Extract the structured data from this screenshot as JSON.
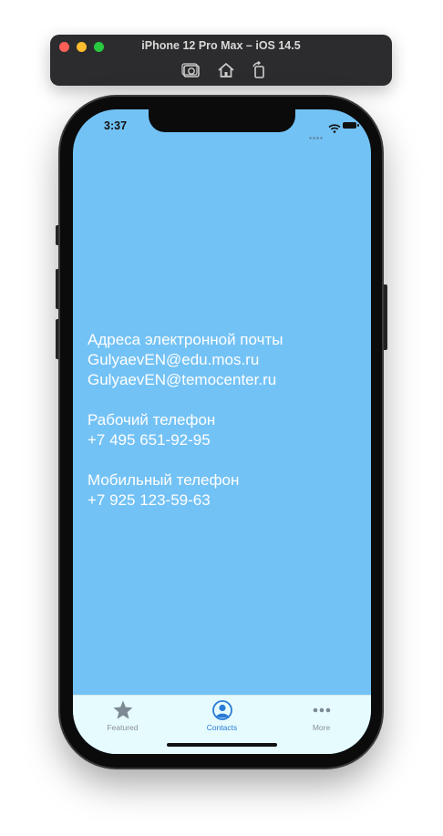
{
  "window": {
    "title": "iPhone 12 Pro Max – iOS 14.5",
    "tools": [
      "screenshot-icon",
      "home-icon",
      "rotate-icon"
    ]
  },
  "status_bar": {
    "time": "3:37",
    "icons": [
      "signal-dots-icon",
      "wifi-icon",
      "battery-icon"
    ]
  },
  "contacts": {
    "email_heading": "Адреса электронной почты",
    "email_1": "GulyaevEN@edu.mos.ru",
    "email_2": "GulyaevEN@temocenter.ru",
    "work_phone_heading": "Рабочий телефон",
    "work_phone": "+7 495 651-92-95",
    "mobile_phone_heading": "Мобильный телефон",
    "mobile_phone": "+7 925 123-59-63"
  },
  "tabbar": {
    "tabs": [
      {
        "label": "Featured",
        "icon": "star-icon",
        "selected": false
      },
      {
        "label": "Contacts",
        "icon": "person-circle-icon",
        "selected": true
      },
      {
        "label": "More",
        "icon": "ellipsis-icon",
        "selected": false
      }
    ]
  },
  "colors": {
    "screen_background": "#73c2f5",
    "tabbar_background": "#e6fbfd",
    "tab_selected": "#2a7bd6",
    "tab_unselected": "#8a8f96"
  }
}
